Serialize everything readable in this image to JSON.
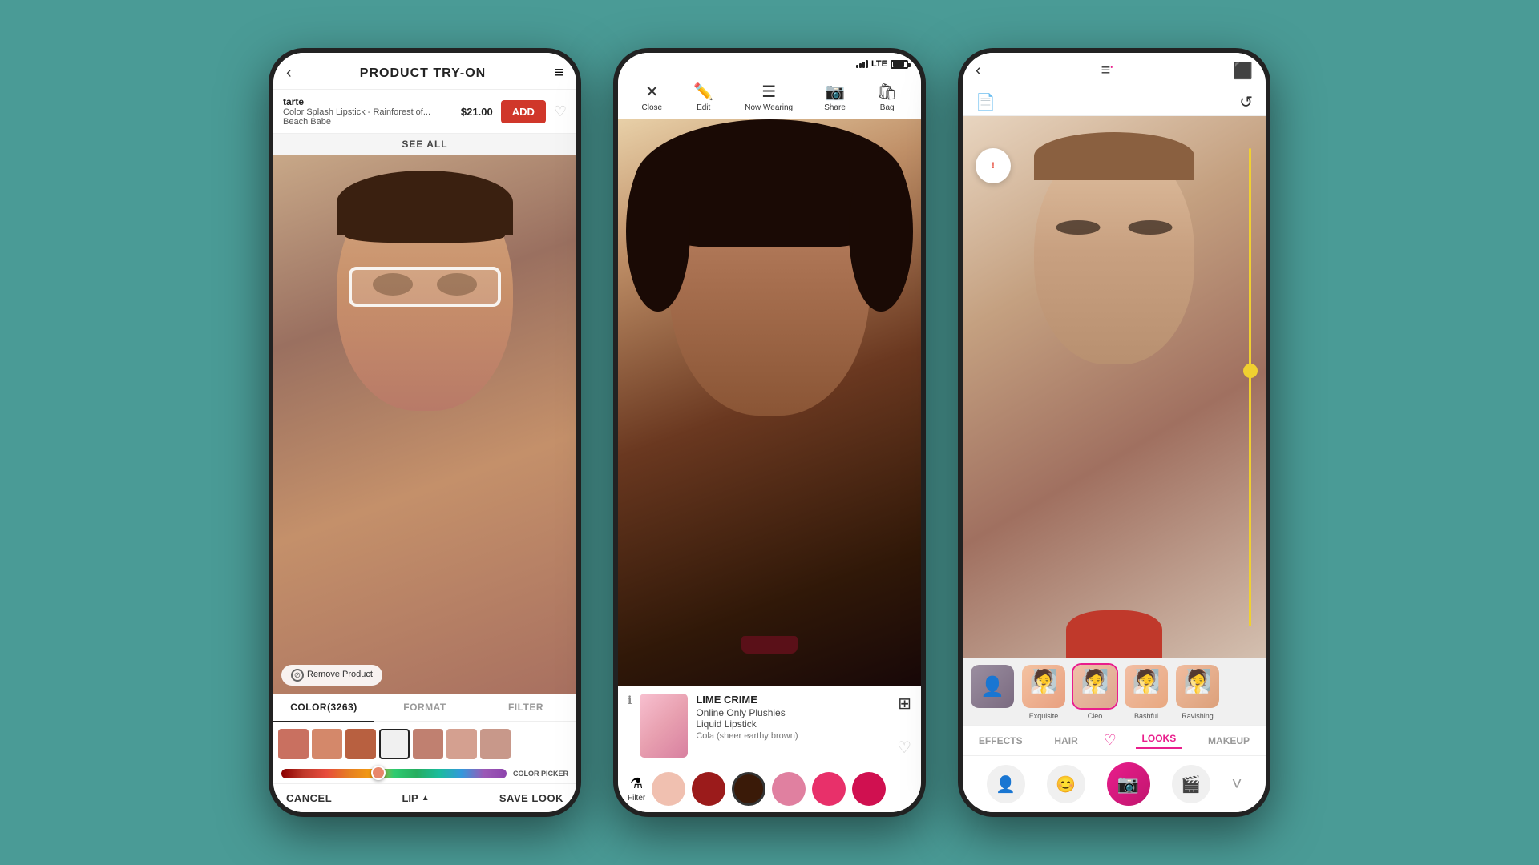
{
  "background_color": "#4a9b96",
  "phone1": {
    "title": "PRODUCT TRY-ON",
    "brand": "tarte",
    "product_name": "Color Splash Lipstick - Rainforest of...",
    "product_sub": "Beach Babe",
    "price": "$21.00",
    "add_label": "ADD",
    "see_all_label": "SEE ALL",
    "remove_label": "Remove\nProduct",
    "tabs": [
      "COLOR(3263)",
      "FORMAT",
      "FILTER"
    ],
    "active_tab": 0,
    "color_picker_label": "COLOR\nPICKER",
    "cancel_label": "CANCEL",
    "lip_label": "LIP",
    "save_label": "SAVE LOOK",
    "swatches": [
      {
        "color": "#c97060"
      },
      {
        "color": "#d4886a"
      },
      {
        "color": "#b86040"
      },
      {
        "color": "#f0f0f0",
        "selected": true
      },
      {
        "color": "#c08070"
      },
      {
        "color": "#d4a090"
      },
      {
        "color": "#c8988a"
      }
    ]
  },
  "phone2": {
    "status": {
      "lte_label": "LTE",
      "signal_label": "signal"
    },
    "toolbar": {
      "close_label": "Close",
      "edit_label": "Edit",
      "now_wearing_label": "Now Wearing",
      "share_label": "Share",
      "bag_label": "Bag"
    },
    "product": {
      "brand": "LIME CRIME",
      "line": "Online Only Plushies",
      "type": "Liquid Lipstick",
      "shade": "Cola (sheer earthy brown)"
    },
    "filter_label": "Filter",
    "shades": [
      {
        "color": "#f0c0b0",
        "selected": false
      },
      {
        "color": "#9b1b1b",
        "selected": false
      },
      {
        "color": "#3a1a08",
        "selected": true
      },
      {
        "color": "#e080a0",
        "selected": false
      },
      {
        "color": "#e8306a",
        "selected": false
      },
      {
        "color": "#d01050",
        "selected": false
      }
    ]
  },
  "phone3": {
    "looks_strip": [
      {
        "label": "",
        "type": "user"
      },
      {
        "label": "Exquisite"
      },
      {
        "label": "Cleo",
        "selected": true
      },
      {
        "label": "Bashful"
      },
      {
        "label": "Ravishing"
      }
    ],
    "cat_tabs": [
      "EFFECTS",
      "HAIR",
      "♡",
      "LOOKS",
      "MAKEUP"
    ],
    "active_cat": "LOOKS",
    "bottom_actions": [
      {
        "icon": "👤",
        "label": "avatar"
      },
      {
        "icon": "😊",
        "label": "face"
      },
      {
        "icon": "📷",
        "label": "camera",
        "active": true
      },
      {
        "icon": "🎬",
        "label": "video"
      }
    ]
  }
}
